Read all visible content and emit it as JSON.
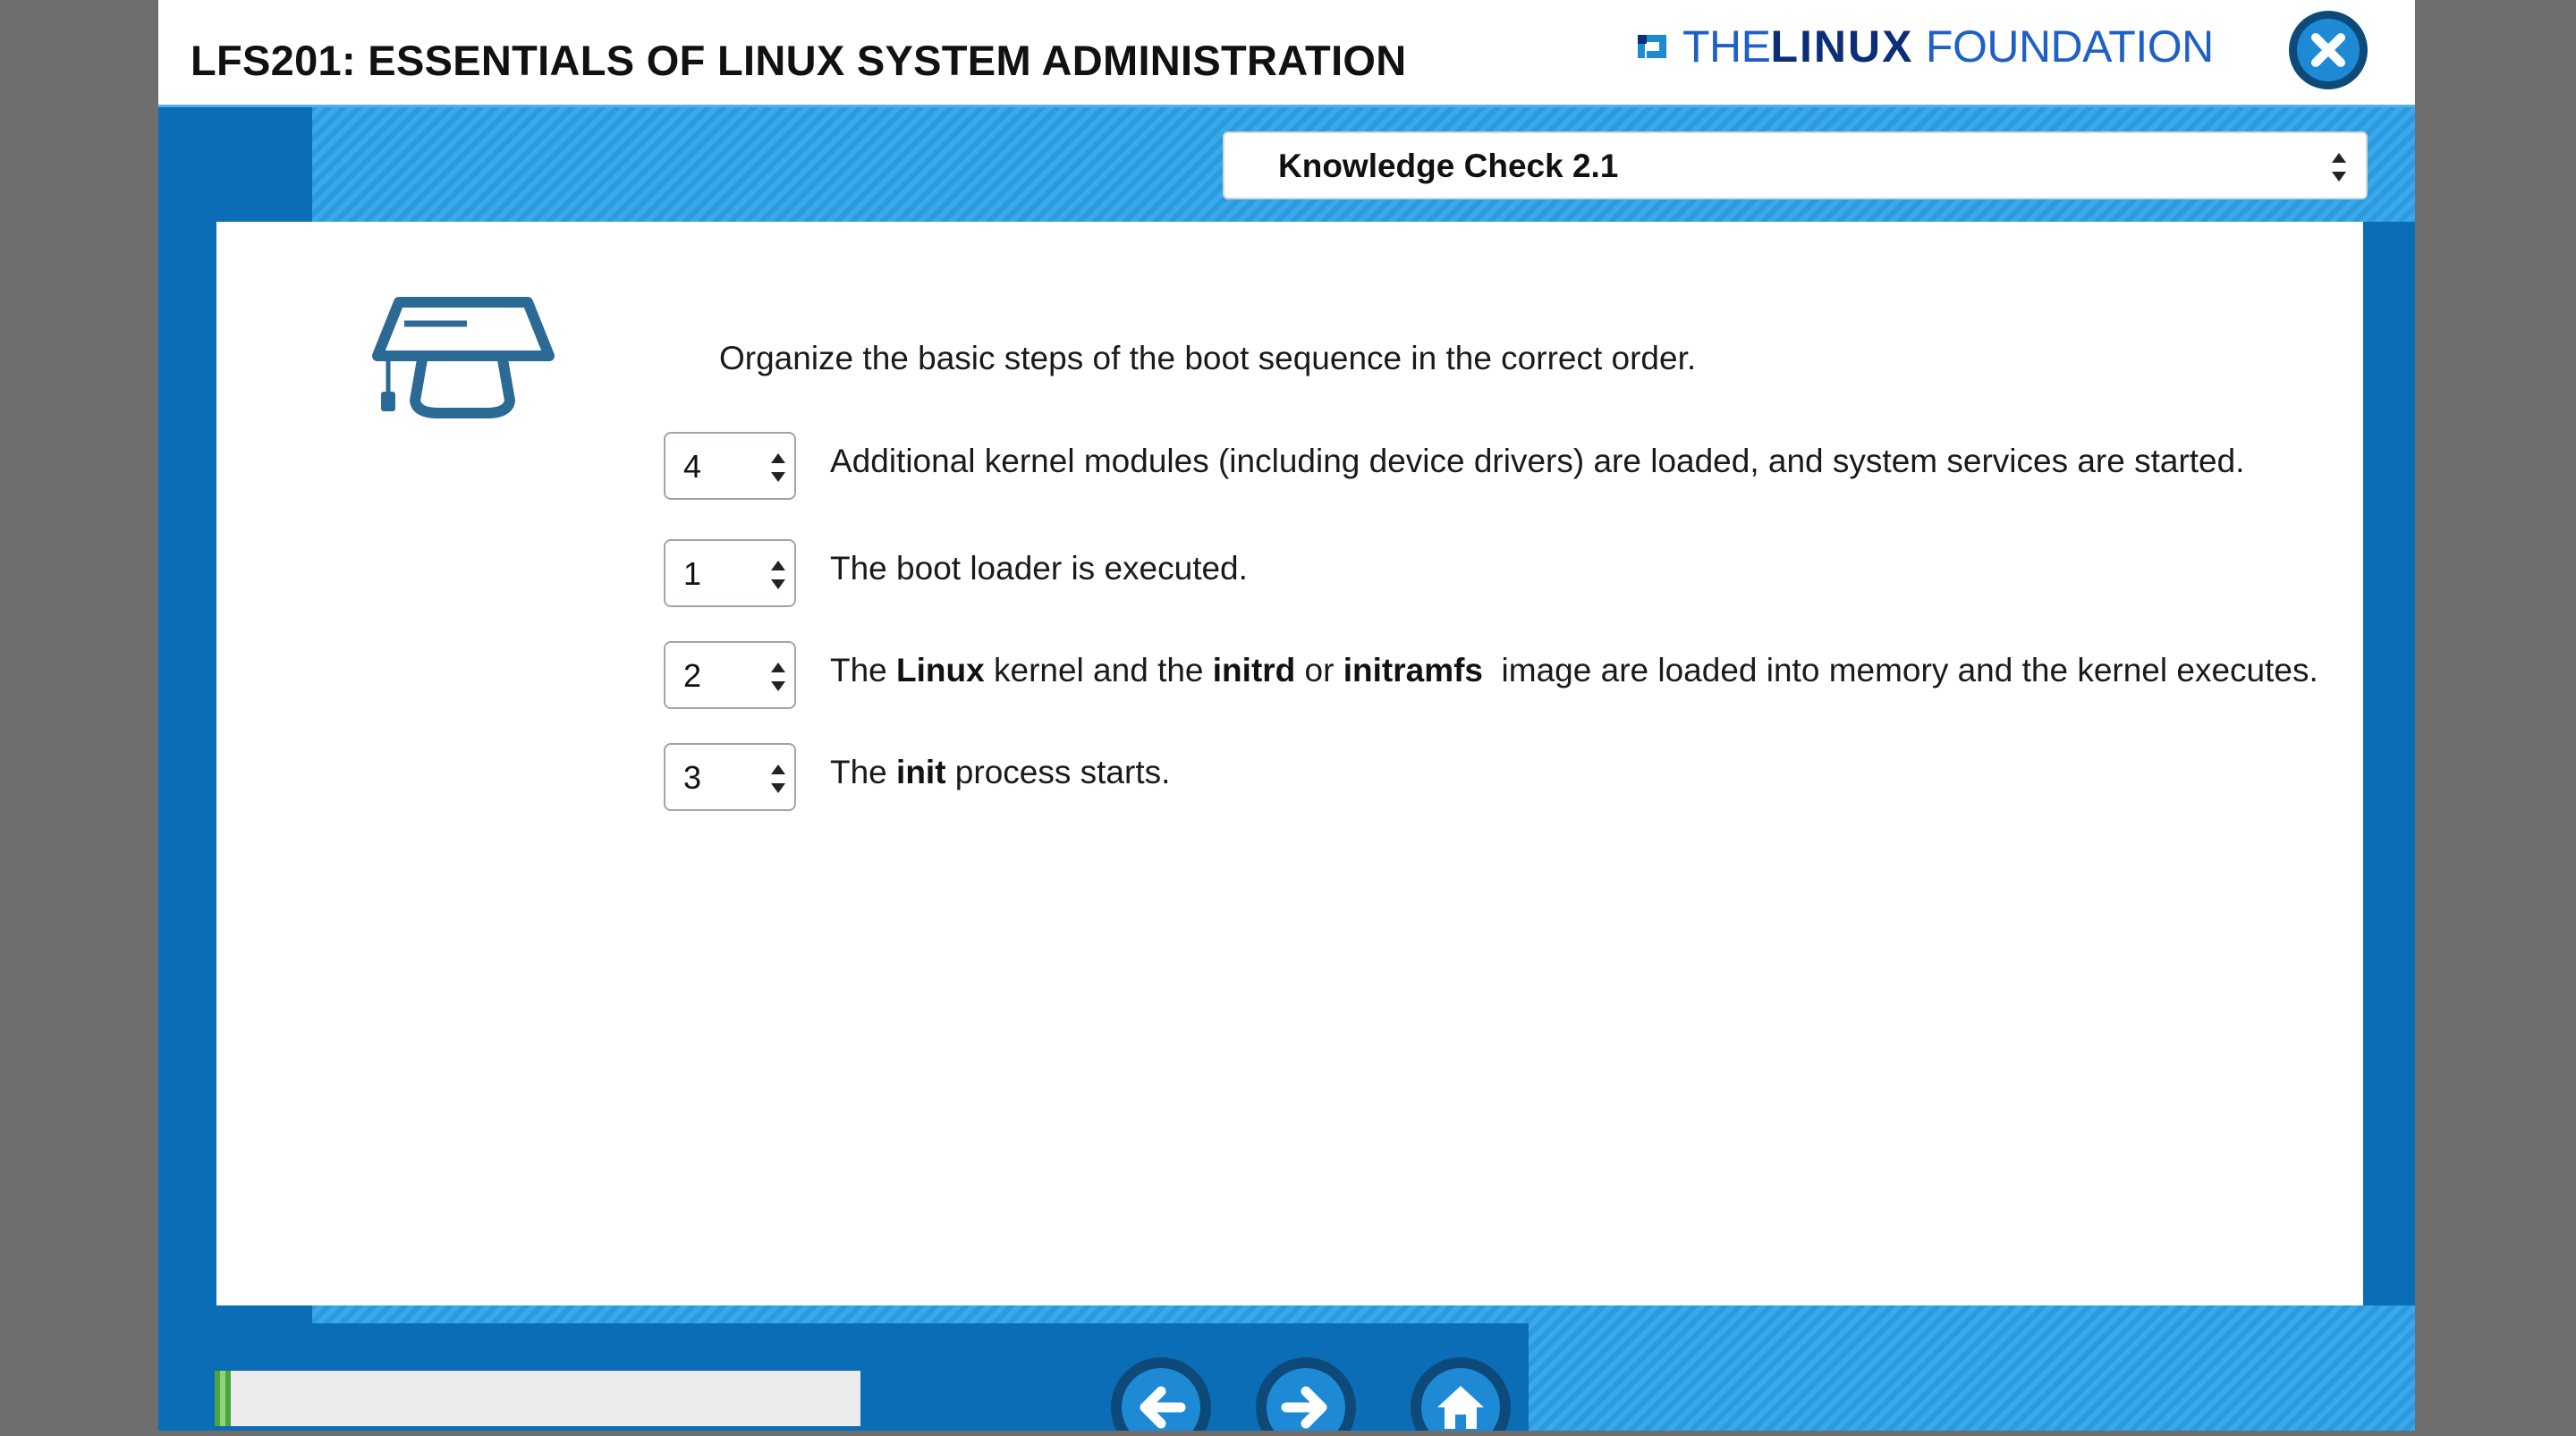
{
  "header": {
    "course_title": "LFS201: ESSENTIALS OF LINUX SYSTEM ADMINISTRATION",
    "brand": {
      "the": "THE",
      "linux": "LINUX",
      "foundation": "FOUNDATION"
    },
    "close_icon": "close-x-icon"
  },
  "topic_select": {
    "selected": "Knowledge Check 2.1"
  },
  "question": {
    "prompt": "Organize the basic steps of the boot sequence in the correct order.",
    "icon": "graduation-cap-icon",
    "items": [
      {
        "order": "4",
        "text": "Additional kernel modules (including device drivers) are loaded, and system services are started."
      },
      {
        "order": "1",
        "text": "The boot loader is executed."
      },
      {
        "order": "2",
        "parts": [
          "The ",
          "Linux",
          " kernel and the ",
          "initrd",
          " or ",
          "initramfs",
          "  image are loaded into memory and the kernel executes."
        ]
      },
      {
        "order": "3",
        "parts": [
          "The ",
          "init",
          " process starts."
        ]
      }
    ]
  },
  "footer": {
    "progress_fraction": 0.025,
    "nav": [
      "back-arrow-icon",
      "forward-arrow-icon",
      "home-icon"
    ]
  },
  "colors": {
    "primary": "#0a6db5",
    "stripe": "#2b9be0",
    "nav_button": "#1e8ad6",
    "progress": "#4aa63c"
  }
}
